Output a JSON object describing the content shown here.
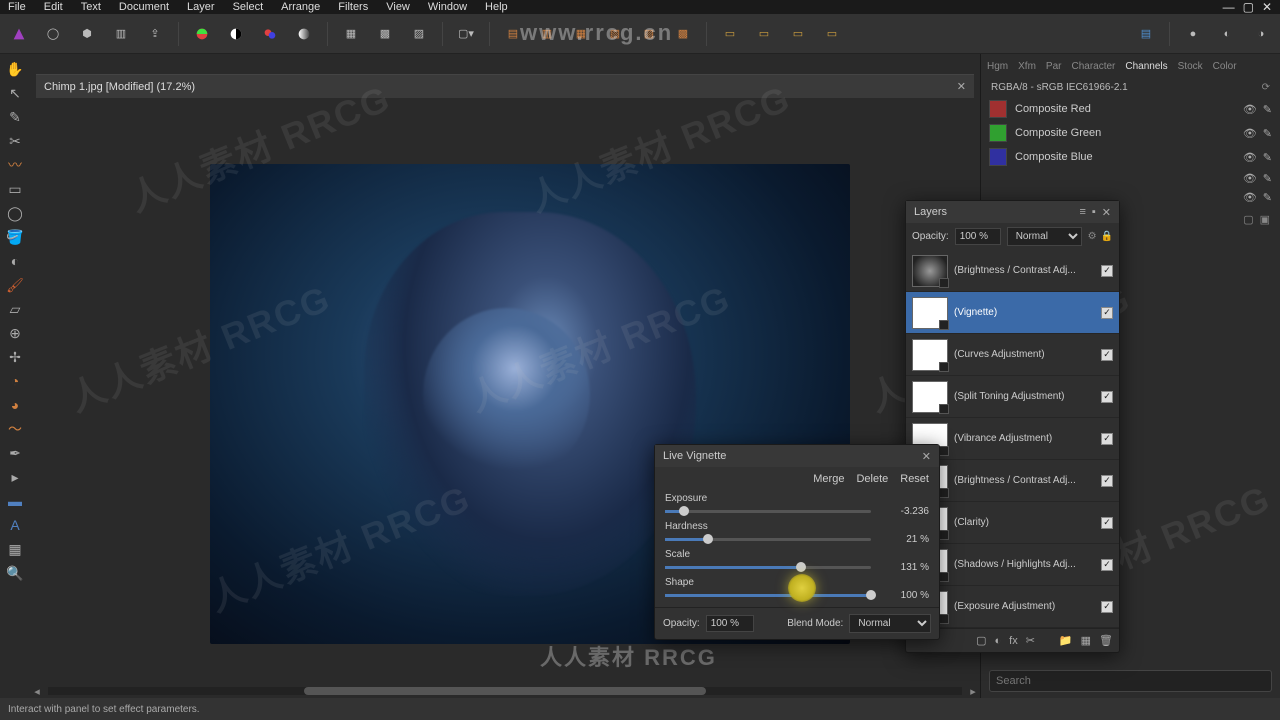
{
  "menu": {
    "items": [
      "File",
      "Edit",
      "Text",
      "Document",
      "Layer",
      "Select",
      "Arrange",
      "Filters",
      "View",
      "Window",
      "Help"
    ]
  },
  "document": {
    "tab_label": "Chimp 1.jpg [Modified] (17.2%)"
  },
  "right_panel": {
    "tabs": [
      "Hgm",
      "Xfm",
      "Par",
      "Character",
      "Channels",
      "Stock",
      "Color"
    ],
    "active_tab": "Channels",
    "color_mode": "RGBA/8 - sRGB IEC61966-2.1",
    "channels": [
      {
        "name": "Composite Red",
        "color": "#a03030"
      },
      {
        "name": "Composite Green",
        "color": "#30a030"
      },
      {
        "name": "Composite Blue",
        "color": "#3030a0"
      }
    ],
    "search_placeholder": "Search"
  },
  "layers": {
    "title": "Layers",
    "opacity_label": "Opacity:",
    "opacity_value": "100 %",
    "blend_mode": "Normal",
    "items": [
      {
        "name": "(Brightness / Contrast Adj...",
        "thumb": "dark",
        "checked": true
      },
      {
        "name": "(Vignette)",
        "thumb": "white",
        "checked": true,
        "selected": true
      },
      {
        "name": "(Curves Adjustment)",
        "thumb": "white",
        "checked": true
      },
      {
        "name": "(Split Toning Adjustment)",
        "thumb": "white",
        "checked": true
      },
      {
        "name": "(Vibrance Adjustment)",
        "thumb": "white",
        "checked": true
      },
      {
        "name": "(Brightness / Contrast Adj...",
        "thumb": "white",
        "checked": true
      },
      {
        "name": "(Clarity)",
        "thumb": "white",
        "checked": true
      },
      {
        "name": "(Shadows / Highlights Adj...",
        "thumb": "white",
        "checked": true
      },
      {
        "name": "(Exposure Adjustment)",
        "thumb": "white",
        "checked": true
      }
    ]
  },
  "vignette": {
    "title": "Live Vignette",
    "buttons": {
      "merge": "Merge",
      "delete": "Delete",
      "reset": "Reset"
    },
    "sliders": [
      {
        "label": "Exposure",
        "value": "-3.236",
        "pos": 9
      },
      {
        "label": "Hardness",
        "value": "21 %",
        "pos": 21
      },
      {
        "label": "Scale",
        "value": "131 %",
        "pos": 66
      },
      {
        "label": "Shape",
        "value": "100 %",
        "pos": 100
      }
    ],
    "footer": {
      "opacity_label": "Opacity:",
      "opacity_value": "100 %",
      "blend_label": "Blend Mode:",
      "blend_value": "Normal"
    }
  },
  "status": {
    "text": "Interact with panel to set effect parameters."
  },
  "watermark": {
    "url": "www.rrcg.cn",
    "text": "人人素材 RRCG"
  }
}
